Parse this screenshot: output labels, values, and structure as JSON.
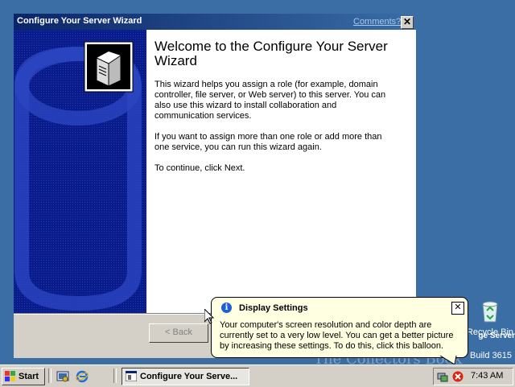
{
  "desktop": {
    "recycle_bin_label": "Recycle Bin",
    "watermark_line1": "ge Server",
    "build_text": "Build 3615",
    "collectors_mark": "The Collectors Book"
  },
  "wizard": {
    "title": "Configure Your Server Wizard",
    "comments_link": "Comments?",
    "close_glyph": "✕",
    "welcome_title": "Welcome to the Configure Your Server Wizard",
    "paragraph1": "This wizard helps you assign a role (for example, domain controller, file server, or Web server) to this server. You can also use this wizard to install collaboration and communication services.",
    "paragraph2": "If you want to assign more than one role or add more than one service, you can run this wizard again.",
    "paragraph3": "To continue, click Next.",
    "back_button": "< Back"
  },
  "balloon": {
    "title": "Display Settings",
    "text": "Your computer's screen resolution and color depth are currently set to a very low level. You can get a better picture by increasing these settings. To do this, click this balloon.",
    "close_glyph": "✕",
    "info_glyph": "i"
  },
  "taskbar": {
    "start_label": "Start",
    "task_label": "Configure Your Serve...",
    "clock": "7:43 AM"
  },
  "colors": {
    "desktop": "#3a6ea5",
    "titlebar_start": "#0a246a",
    "banner": "#0a1c8c",
    "balloon_bg": "#ffffe1"
  }
}
